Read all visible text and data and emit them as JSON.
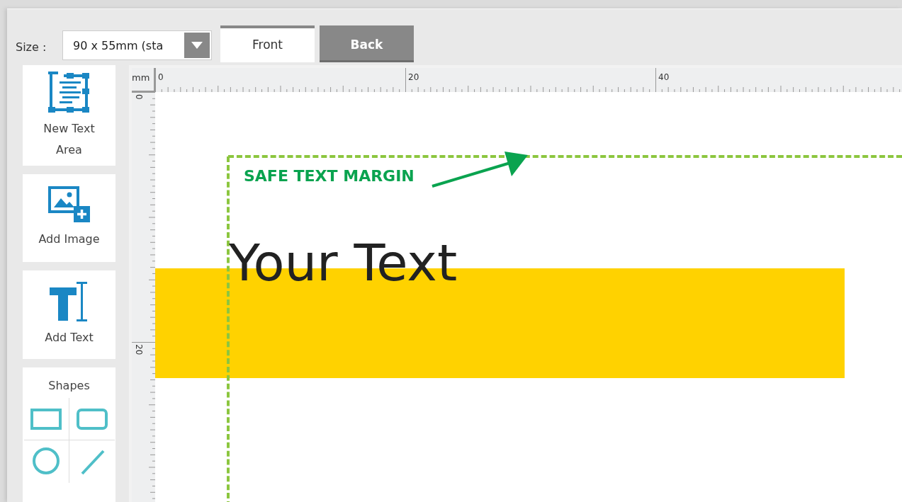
{
  "toolbar": {
    "size_label": "Size :",
    "size_value": "90 x 55mm (sta",
    "tabs": [
      {
        "label": "Front",
        "selected": true
      },
      {
        "label": "Back",
        "selected": false
      }
    ]
  },
  "tools": [
    {
      "kind": "text-area",
      "label": "New Text Area"
    },
    {
      "kind": "image",
      "label": "Add Image"
    },
    {
      "kind": "text",
      "label": "Add Text"
    }
  ],
  "shapes": {
    "title": "Shapes",
    "items": [
      {
        "kind": "rectangle"
      },
      {
        "kind": "rounded"
      },
      {
        "kind": "circle"
      },
      {
        "kind": "line"
      }
    ]
  },
  "rulers": {
    "unit": "mm",
    "top_labels": [
      "0",
      "20",
      "40"
    ],
    "left_labels": [
      "0",
      "20"
    ]
  },
  "canvas": {
    "margin_label": "SAFE TEXT MARGIN",
    "text": "Your Text"
  }
}
